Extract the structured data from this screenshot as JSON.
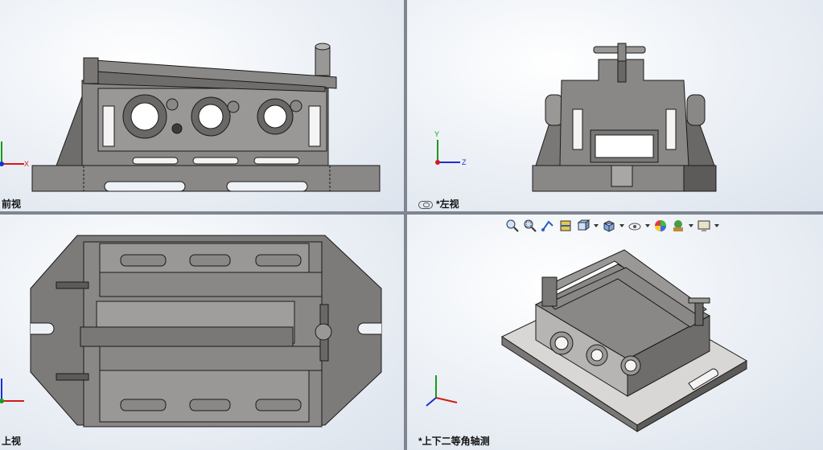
{
  "viewports": {
    "front": {
      "label": "前视"
    },
    "left": {
      "label": "*左视"
    },
    "top": {
      "label": "上视"
    },
    "iso": {
      "label": "*上下二等角轴测"
    }
  },
  "axes": {
    "x": "X",
    "y": "Y",
    "z": "Z"
  },
  "toolbar": {
    "buttons": [
      {
        "name": "zoom-to-fit-icon"
      },
      {
        "name": "zoom-to-area-icon"
      },
      {
        "name": "previous-view-icon"
      },
      {
        "name": "section-view-icon"
      },
      {
        "name": "view-orientation-icon"
      },
      {
        "name": "display-style-icon"
      },
      {
        "name": "hide-show-items-icon"
      },
      {
        "name": "edit-appearance-icon"
      },
      {
        "name": "apply-scene-icon"
      },
      {
        "name": "view-settings-icon"
      }
    ]
  },
  "colors": {
    "part_fill": "#8a8886",
    "part_dark": "#5d5b5a",
    "part_light": "#b7b5b3",
    "edge": "#1a1a1a",
    "viewport_border": "#7f8591",
    "axis_x": "#d21a1a",
    "axis_y": "#1a9a1a",
    "axis_z": "#1a2fd2"
  }
}
